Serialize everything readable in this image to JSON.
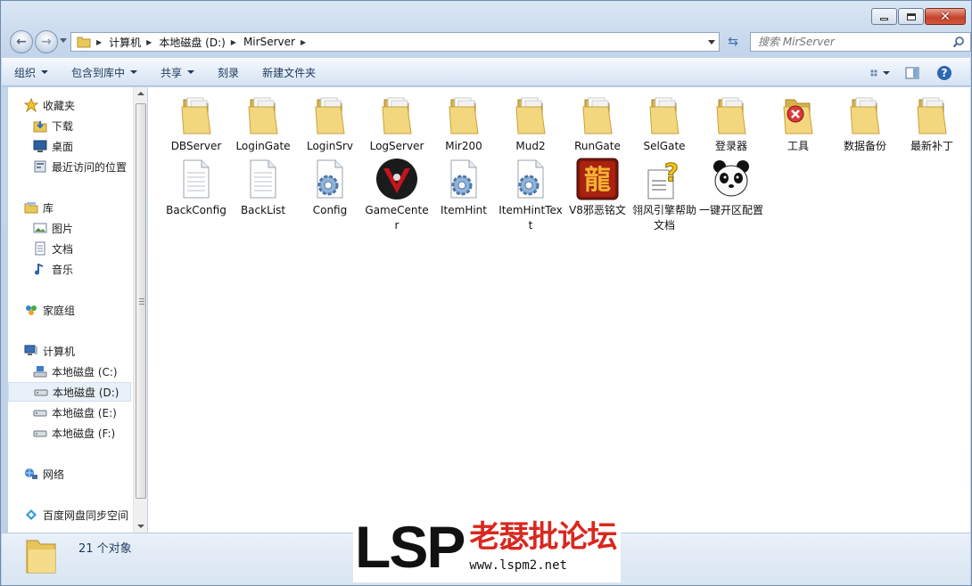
{
  "window": {
    "controls": {
      "minimize": "minimize",
      "maximize": "maximize",
      "close": "close"
    }
  },
  "address_bar": {
    "crumbs": [
      "计算机",
      "本地磁盘 (D:)",
      "MirServer"
    ]
  },
  "search": {
    "placeholder": "搜索 MirServer"
  },
  "toolbar": {
    "organize": "组织",
    "include_in_library": "包含到库中",
    "share": "共享",
    "burn": "刻录",
    "new_folder": "新建文件夹"
  },
  "sidebar": {
    "favorites": "收藏夹",
    "favorites_items": [
      "下载",
      "桌面",
      "最近访问的位置"
    ],
    "libraries": "库",
    "libraries_items": [
      "图片",
      "文档",
      "音乐"
    ],
    "homegroup": "家庭组",
    "computer": "计算机",
    "drives": [
      "本地磁盘 (C:)",
      "本地磁盘 (D:)",
      "本地磁盘 (E:)",
      "本地磁盘 (F:)"
    ],
    "network": "网络",
    "baidu": "百度网盘同步空间"
  },
  "files": {
    "row1": [
      "DBServer",
      "LoginGate",
      "LoginSrv",
      "LogServer",
      "Mir200",
      "Mud2",
      "RunGate",
      "SelGate",
      "登录器",
      "工具",
      "数据备份",
      "最新补丁"
    ],
    "row2": [
      "BackConfig",
      "BackList",
      "Config",
      "GameCenter",
      "ItemHint",
      "ItemHintText",
      "V8邪恶铭文",
      "翎风引擎帮助文档",
      "一键开区配置"
    ]
  },
  "status": {
    "count": "21 个对象"
  },
  "watermark": {
    "lsp": "LSP",
    "cn": "老瑟批论坛",
    "url": "www.lspm2.net"
  }
}
